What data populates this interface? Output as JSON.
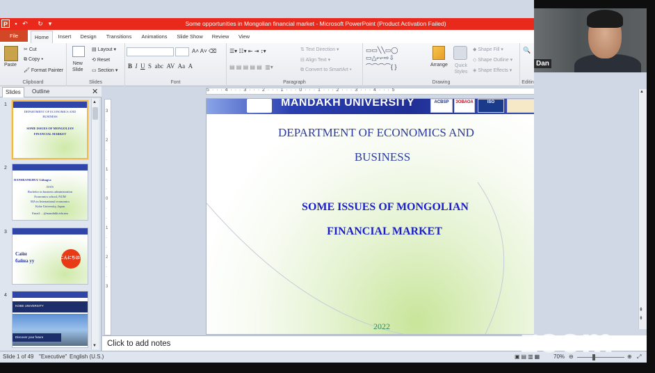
{
  "window": {
    "title": "Some opportunities in Mongolian financial market - Microsoft PowerPoint (Product Activation Failed)"
  },
  "tabs": [
    "File",
    "Home",
    "Insert",
    "Design",
    "Transitions",
    "Animations",
    "Slide Show",
    "Review",
    "View"
  ],
  "ribbon": {
    "clipboard": {
      "paste": "Paste",
      "cut": "Cut",
      "copy": "Copy",
      "format_painter": "Format Painter",
      "label": "Clipboard"
    },
    "slides": {
      "new_slide": "New\nSlide",
      "layout": "Layout",
      "reset": "Reset",
      "section": "Section",
      "label": "Slides"
    },
    "font": {
      "label": "Font"
    },
    "paragraph": {
      "text_direction": "Text Direction",
      "align_text": "Align Text",
      "convert": "Convert to SmartArt",
      "label": "Paragraph"
    },
    "drawing": {
      "arrange": "Arrange",
      "quick_styles": "Quick Styles",
      "shape_fill": "Shape Fill",
      "shape_outline": "Shape Outline",
      "shape_effects": "Shape Effects",
      "label": "Drawing"
    },
    "editing": {
      "label": "Editing"
    }
  },
  "panel": {
    "tab_slides": "Slides",
    "tab_outline": "Outline"
  },
  "thumbnails": [
    {
      "num": "1",
      "lines": [
        "DEPARTMENT OF ECONOMICS AND",
        "BUSINESS",
        "",
        "SOME ISSUES OF MONGOLIAN",
        "FINANCIAL MARKET"
      ]
    },
    {
      "num": "2",
      "lines": [
        "DANSRANKHUU Lkhagva",
        "DAN",
        "Bachelor in business administration",
        "Economics school, NUM",
        "MA in International economics",
        "Kobe University, Japan",
        "Email: ...@mandakh.edu.mn"
      ]
    },
    {
      "num": "3",
      "lines": [
        "Сайн",
        "байна уу",
        "こんにちは!"
      ]
    },
    {
      "num": "4",
      "lines": [
        "KOBE UNIVERSITY",
        "Discover your future"
      ]
    }
  ],
  "slide": {
    "banner": "MANDAKH UNIVERSITY",
    "logos": [
      "ACBSP",
      "ЗОВАОА",
      "ISO"
    ],
    "dept_line1": "DEPARTMENT OF ECONOMICS AND",
    "dept_line2": "BUSINESS",
    "issue_line1": "SOME ISSUES OF MONGOLIAN",
    "issue_line2": "FINANCIAL MARKET",
    "year": "2022"
  },
  "notes": {
    "placeholder": "Click to add notes"
  },
  "status": {
    "slide_of": "Slide 1 of 49",
    "theme": "\"Executive\"",
    "language": "English (U.S.)",
    "zoom": "70%"
  },
  "video": {
    "participant_name": "Dan"
  },
  "watermark": "zoom"
}
